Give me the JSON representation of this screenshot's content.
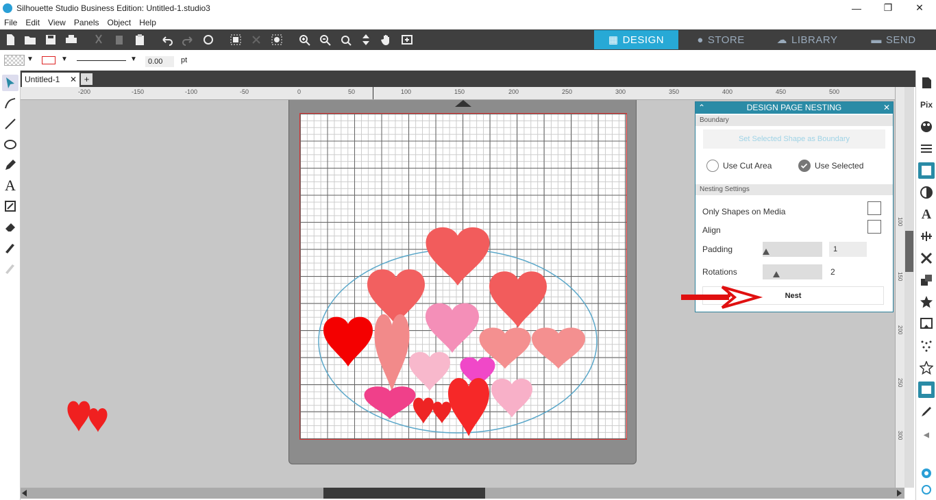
{
  "window": {
    "title": "Silhouette Studio Business Edition: Untitled-1.studio3",
    "minimize": "—",
    "maximize": "❐",
    "close": "✕"
  },
  "menu": [
    "File",
    "Edit",
    "View",
    "Panels",
    "Object",
    "Help"
  ],
  "nav_tabs": [
    {
      "label": "DESIGN",
      "icon": "grid-icon",
      "active": true
    },
    {
      "label": "STORE",
      "icon": "store-icon",
      "active": false
    },
    {
      "label": "LIBRARY",
      "icon": "cloud-icon",
      "active": false
    },
    {
      "label": "SEND",
      "icon": "cutter-icon",
      "active": false
    }
  ],
  "properties": {
    "line_width_value": "0.00",
    "line_width_unit": "pt"
  },
  "document_tab": {
    "name": "Untitled-1",
    "close": "✕",
    "add": "+"
  },
  "ruler_top": [
    "-200",
    "-150",
    "-100",
    "-50",
    "0",
    "50",
    "100",
    "150",
    "200",
    "250",
    "300",
    "350",
    "400",
    "450",
    "500"
  ],
  "ruler_right": [
    "100",
    "150",
    "200",
    "250",
    "300"
  ],
  "nesting_panel": {
    "title": "DESIGN PAGE NESTING",
    "boundary_section": "Boundary",
    "set_boundary_button": "Set Selected Shape as Boundary",
    "use_cut_area": "Use Cut Area",
    "use_selected": "Use Selected",
    "boundary_selected": "Use Selected",
    "settings_section": "Nesting Settings",
    "only_shapes_on_media": "Only Shapes on Media",
    "align": "Align",
    "padding_label": "Padding",
    "padding_value": "1",
    "padding_slider": 0.0,
    "rotations_label": "Rotations",
    "rotations_value": "2",
    "rotations_slider": 0.2,
    "nest_button": "Nest"
  },
  "colors": {
    "accent": "#27a9d6",
    "panel_header": "#2a8ba6",
    "arrow": "#e01010"
  }
}
